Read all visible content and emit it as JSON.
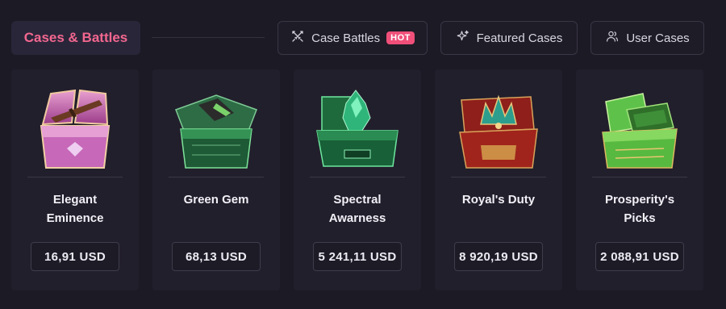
{
  "header": {
    "title": "Cases & Battles",
    "tabs": [
      {
        "label": "Case Battles",
        "badge": "HOT",
        "icon": "swords-icon"
      },
      {
        "label": "Featured Cases",
        "icon": "sparkles-icon"
      },
      {
        "label": "User Cases",
        "icon": "users-icon"
      }
    ]
  },
  "colors": {
    "accent": "#f3678f",
    "badge": "#ef4f79",
    "background": "#1c1a24",
    "card": "#221f2c"
  },
  "cases": [
    {
      "name": "Elegant Eminence",
      "price": "16,91 USD",
      "theme": "pink"
    },
    {
      "name": "Green Gem",
      "price": "68,13 USD",
      "theme": "green-glass"
    },
    {
      "name": "Spectral Awarness",
      "price": "5 241,11 USD",
      "theme": "emerald"
    },
    {
      "name": "Royal's Duty",
      "price": "8 920,19 USD",
      "theme": "red"
    },
    {
      "name": "Prosperity's Picks",
      "price": "2 088,91 USD",
      "theme": "lime"
    }
  ]
}
